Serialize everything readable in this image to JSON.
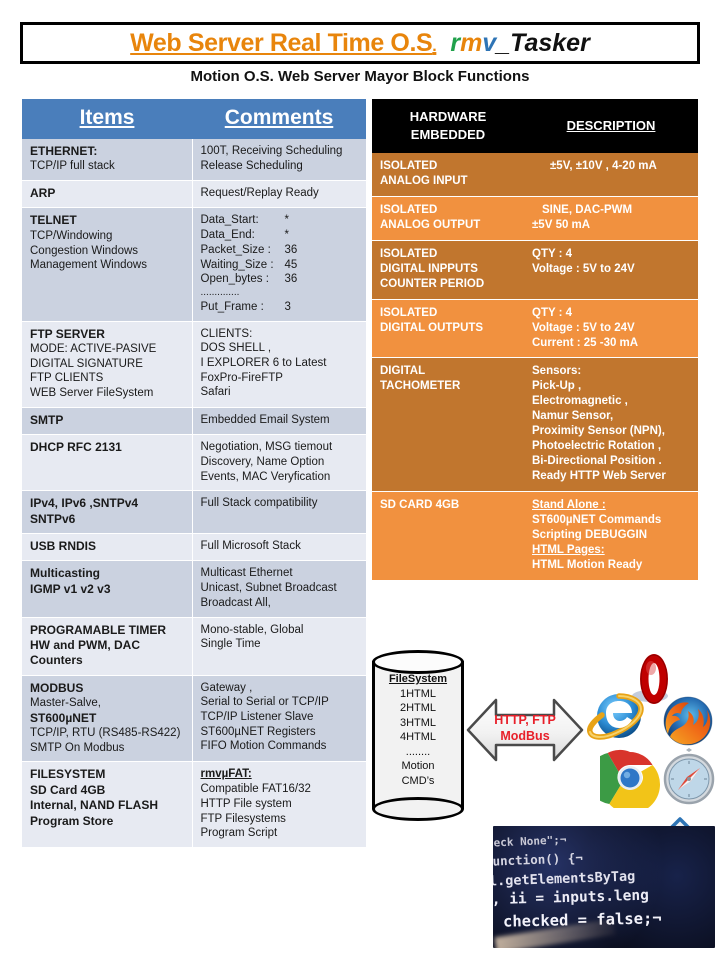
{
  "header": {
    "title_main": "Web Server Real Time O.S",
    "title_main_dot": ".",
    "brand_r": "r",
    "brand_m": "m",
    "brand_v": "v",
    "brand_rest": "_Tasker",
    "subtitle": "Motion O.S. Web Server  Mayor Block Functions",
    "accent_orange": "#E8850C",
    "accent_green": "#21A14B",
    "accent_blue": "#2E74B5"
  },
  "left_table": {
    "header_color": "#4A7EBB",
    "columns": [
      "Items",
      "Comments"
    ],
    "rows": [
      {
        "band": "a",
        "item_title": "ETHERNET:",
        "item_lines": [
          "TCP/IP full stack"
        ],
        "comment_lines": [
          "100T, Receiving  Scheduling",
          "Release Scheduling"
        ]
      },
      {
        "band": "b",
        "item_title": "ARP",
        "item_lines": [],
        "comment_lines": [
          "Request/Replay Ready"
        ]
      },
      {
        "band": "a",
        "item_title": "TELNET",
        "item_lines": [
          "TCP/Windowing",
          "Congestion Windows",
          "Management Windows"
        ],
        "comment_pairs": [
          {
            "k": "Data_Start:",
            "v": "*"
          },
          {
            "k": "Data_End:",
            "v": "*"
          },
          {
            "k": "Packet_Size :",
            "v": "36"
          },
          {
            "k": "Waiting_Size :",
            "v": "45"
          },
          {
            "k": "Open_bytes   :",
            "v": "36"
          },
          {
            "k": "..............",
            "v": ""
          },
          {
            "k": "Put_Frame   :",
            "v": "3"
          }
        ]
      },
      {
        "band": "b",
        "item_title": "FTP SERVER",
        "item_lines": [
          "MODE: ACTIVE-PASIVE",
          "DIGITAL SIGNATURE",
          "FTP CLIENTS",
          "WEB Server FileSystem"
        ],
        "comment_lines": [
          "CLIENTS:",
          "DOS SHELL ,",
          "I EXPLORER  6 to Latest",
          "FoxPro-FireFTP",
          "Safari"
        ]
      },
      {
        "band": "a",
        "item_title": "SMTP",
        "item_lines": [],
        "comment_lines": [
          "Embedded  Email  System"
        ]
      },
      {
        "band": "b",
        "item_title": "DHCP          RFC  2131",
        "item_lines": [],
        "comment_lines": [
          "Negotiation, MSG tiemout",
          "Discovery, Name  Option",
          "Events,  MAC Veryfication"
        ]
      },
      {
        "band": "a",
        "item_title": "IPv4, IPv6 ,SNTPv4",
        "item_lines_bold": [
          "SNTPv6"
        ],
        "comment_lines": [
          "Full Stack compatibility"
        ]
      },
      {
        "band": "b",
        "item_title": "USB RNDIS",
        "item_lines": [],
        "comment_lines": [
          "Full Microsoft  Stack"
        ]
      },
      {
        "band": "a",
        "item_title": "Multicasting",
        "item_lines_bold": [
          "IGMP v1 v2 v3"
        ],
        "comment_lines": [
          "Multicast Ethernet",
          "Unicast, Subnet  Broadcast",
          "Broadcast All,"
        ]
      },
      {
        "band": "b",
        "item_title": "PROGRAMABLE TIMER",
        "item_lines_bold": [
          "HW and PWM, DAC",
          "Counters"
        ],
        "comment_lines": [
          "Mono-stable, Global",
          "Single  Time"
        ]
      },
      {
        "band": "a",
        "item_title": "MODBUS",
        "item_lines": [
          "Master-Salve,"
        ],
        "item_line_bold2": "ST600µNET",
        "item_lines2": [
          "TCP/IP, RTU (RS485-RS422)",
          "SMTP On Modbus"
        ],
        "comment_lines": [
          "Gateway ,",
          "Serial to Serial  or TCP/IP",
          "TCP/IP Listener Slave",
          "ST600µNET  Registers",
          "FIFO Motion Commands"
        ]
      },
      {
        "band": "b",
        "item_title": "FILESYSTEM",
        "item_lines_bold": [
          "SD Card 4GB",
          "Internal, NAND FLASH",
          "Program Store"
        ],
        "comment_heading": "rmvµFAT:",
        "comment_lines": [
          "Compatible  FAT16/32",
          "HTTP  File system",
          "FTP Filesystems",
          "Program Script"
        ]
      }
    ]
  },
  "right_table": {
    "header_bg": "#000000",
    "row_dark": "#C1762E",
    "row_light": "#F1913F",
    "columns": [
      "HARDWARE\nEMBEDDED",
      "DESCRIPTION"
    ],
    "col1_line1": "HARDWARE",
    "col1_line2": "EMBEDDED",
    "col2": "DESCRIPTION",
    "rows": [
      {
        "band": "dark",
        "hw_lines": [
          "ISOLATED",
          "ANALOG  INPUT"
        ],
        "desc_lines": [
          "±5V, ±10V , 4-20 mA"
        ],
        "desc_indent": true
      },
      {
        "band": "light",
        "hw_lines": [
          "ISOLATED",
          "ANALOG  OUTPUT"
        ],
        "desc_lines": [
          " SINE, DAC-PWM",
          "±5V  50 mA"
        ]
      },
      {
        "band": "dark",
        "hw_lines": [
          "ISOLATED",
          "DIGITAL INPPUTS",
          "COUNTER PERIOD"
        ],
        "desc_lines": [
          "QTY : 4",
          "Voltage : 5V to  24V"
        ]
      },
      {
        "band": "light",
        "hw_lines": [
          "ISOLATED",
          "DIGITAL OUTPUTS"
        ],
        "desc_lines": [
          "QTY : 4",
          "Voltage :  5V to 24V",
          "Current : 25 -30 mA"
        ]
      },
      {
        "band": "dark",
        "hw_lines": [
          "DIGITAL",
          "TACHOMETER"
        ],
        "desc_lines": [
          "Sensors:",
          "Pick-Up ,",
          "Electromagnetic ,",
          "Namur Sensor,",
          "Proximity Sensor (NPN),",
          "Photoelectric Rotation ,",
          "Bi-Directional Position .",
          "Ready HTTP  Web Server"
        ]
      },
      {
        "band": "light",
        "hw_lines": [
          "SD CARD 4GB"
        ],
        "desc_underlined_1": "Stand Alone :",
        "desc_lines": [
          "ST600µNET  Commands",
          "Scripting  DEBUGGIN"
        ],
        "desc_underlined_2": " HTML Pages:",
        "desc_lines2": [
          " HTML Motion Ready"
        ]
      }
    ]
  },
  "diagram": {
    "cylinder_label": "FileSystem",
    "cylinder_lines": [
      "1HTML",
      "2HTML",
      "3HTML",
      "4HTML",
      "........",
      "Motion",
      "CMD’s"
    ],
    "arrow_label_line1": "HTTP, FTP",
    "arrow_label_line2": "ModBus",
    "arrow_label_color": "#E8202A",
    "browser_icons": [
      "opera-icon",
      "internet-explorer-icon",
      "firefox-icon",
      "chrome-icon",
      "safari-icon"
    ],
    "updown_arrow": "up-down-arrow-icon",
    "code_image": {
      "name": "javascript-code-photo",
      "lines": [
        "heck None\";¬",
        "function() {¬",
        "l.getElementsByTag",
        "i, ii = inputs.leng",
        "checked = false;¬"
      ]
    }
  }
}
